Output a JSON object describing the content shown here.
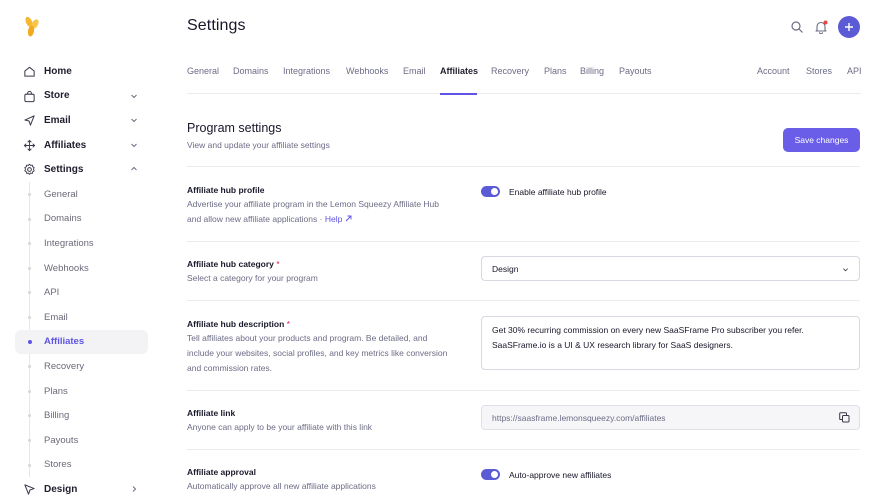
{
  "app": {
    "logo_icon": "lemon-squeezy-logo"
  },
  "sidebar": {
    "items": [
      {
        "label": "Home",
        "icon": "home-icon"
      },
      {
        "label": "Store",
        "icon": "bag-icon",
        "expandable": true
      },
      {
        "label": "Email",
        "icon": "send-icon",
        "expandable": true
      },
      {
        "label": "Affiliates",
        "icon": "affiliate-icon",
        "expandable": true
      },
      {
        "label": "Settings",
        "icon": "gear-icon",
        "expanded": true
      }
    ],
    "settings_sub": [
      "General",
      "Domains",
      "Integrations",
      "Webhooks",
      "API",
      "Email",
      "Affiliates",
      "Recovery",
      "Plans",
      "Billing",
      "Payouts",
      "Stores"
    ],
    "active_sub": "Affiliates",
    "design_item": {
      "label": "Design",
      "icon": "design-icon"
    }
  },
  "header": {
    "title": "Settings"
  },
  "tabs": {
    "left": [
      "General",
      "Domains",
      "Integrations",
      "Webhooks",
      "Email",
      "Affiliates",
      "Recovery",
      "Plans",
      "Billing",
      "Payouts"
    ],
    "right": [
      "Account",
      "Stores",
      "API"
    ],
    "active": "Affiliates"
  },
  "section": {
    "title": "Program settings",
    "subtitle": "View and update your affiliate settings",
    "save_label": "Save changes"
  },
  "rows": {
    "hub_profile": {
      "label": "Affiliate hub profile",
      "desc": "Advertise your affiliate program in the Lemon Squeezy Affiliate Hub and allow new affiliate applications · ",
      "help": "Help",
      "toggle_label": "Enable affiliate hub profile",
      "toggle_on": true
    },
    "hub_category": {
      "label": "Affiliate hub category",
      "required": "*",
      "desc": "Select a category for your program",
      "value": "Design"
    },
    "hub_description": {
      "label": "Affiliate hub description",
      "required": "*",
      "desc": "Tell affiliates about your products and program. Be detailed, and include your websites, social profiles, and key metrics like conversion and commission rates.",
      "value": "Get 30% recurring commission on every new SaaSFrame Pro subscriber you refer. SaaSFrame.io is a UI & UX research library for SaaS designers."
    },
    "affiliate_link": {
      "label": "Affiliate link",
      "desc": "Anyone can apply to be your affiliate with this link",
      "value": "https://saasframe.lemonsqueezy.com/affiliates"
    },
    "affiliate_approval": {
      "label": "Affiliate approval",
      "desc": "Automatically approve all new affiliate applications",
      "toggle_label": "Auto-approve new affiliates",
      "toggle_on": true
    }
  },
  "colors": {
    "accent": "#5f54e6",
    "button": "#6a5ee8",
    "logo": "#f5b82e",
    "notification": "#ef4444"
  }
}
